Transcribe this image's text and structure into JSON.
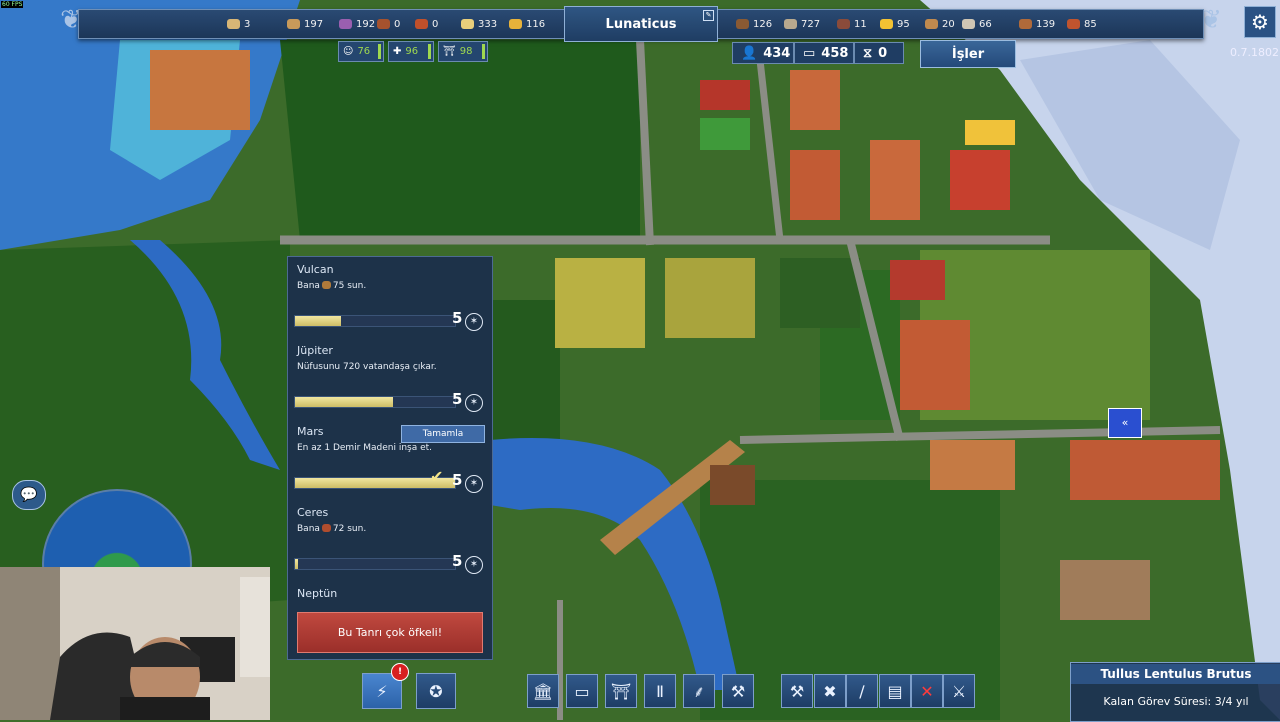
{
  "fps": "60 FPS",
  "city": {
    "name": "Lunaticus"
  },
  "resources_left": [
    {
      "icon": "bread-icon",
      "value": "3",
      "color": "#d8b676"
    },
    {
      "icon": "amphora-icon",
      "value": "197",
      "color": "#c89a5a"
    },
    {
      "icon": "grapes-icon",
      "value": "192",
      "color": "#9a5fb0"
    },
    {
      "icon": "meat-icon",
      "value": "0",
      "color": "#a5522e"
    },
    {
      "icon": "fish-icon",
      "value": "0",
      "color": "#c0502b"
    },
    {
      "icon": "wheat-icon",
      "value": "333",
      "color": "#e9cf7b"
    },
    {
      "icon": "cheese-icon",
      "value": "116",
      "color": "#e7b23a"
    }
  ],
  "resources_right": [
    {
      "icon": "wood-icon",
      "value": "126",
      "color": "#8a5a33"
    },
    {
      "icon": "stone-icon",
      "value": "727",
      "color": "#b8a98e"
    },
    {
      "icon": "iron-icon",
      "value": "11",
      "color": "#8a4b3a"
    },
    {
      "icon": "gold-icon",
      "value": "95",
      "color": "#f2c233"
    },
    {
      "icon": "crate-icon",
      "value": "20",
      "color": "#c08a4e"
    },
    {
      "icon": "marble-icon",
      "value": "66",
      "color": "#cfc6b4"
    },
    {
      "icon": "log-icon",
      "value": "139",
      "color": "#b06a3a"
    },
    {
      "icon": "brick-icon",
      "value": "85",
      "color": "#c0542e"
    }
  ],
  "stats": {
    "happiness": {
      "icon": "happiness-icon",
      "value": "76"
    },
    "health": {
      "icon": "health-icon",
      "value": "96"
    },
    "culture": {
      "icon": "temple-icon",
      "value": "98"
    }
  },
  "population": {
    "value": "434",
    "housing": "458",
    "idle": "0"
  },
  "jobs_label": "İşler",
  "version": "0.7.1802",
  "gods": [
    {
      "name": "Vulcan",
      "desc_prefix": "Bana",
      "desc_suffix": "75 sun.",
      "offer_color": "#b07a3a",
      "progress": 0.29,
      "favor": "5"
    },
    {
      "name": "Jüpiter",
      "desc": "Nüfusunu 720 vatandaşa çıkar.",
      "progress": 0.61,
      "favor": "5"
    },
    {
      "name": "Mars",
      "desc": "En az 1 Demir Madeni inşa et.",
      "progress": 1.0,
      "favor": "5",
      "complete_label": "Tamamla"
    },
    {
      "name": "Ceres",
      "desc_prefix": "Bana",
      "desc_suffix": "72 sun.",
      "offer_color": "#b04d2e",
      "progress": 0.02,
      "favor": "5"
    },
    {
      "name": "Neptün",
      "alert": "Bu Tanrı çok öfkeli!"
    }
  ],
  "toolbar": {
    "powers_badge": "!",
    "buttons": [
      {
        "name": "powers-button",
        "icon": "lightning-icon"
      },
      {
        "name": "favor-button",
        "icon": "laurel-star-icon"
      },
      {
        "name": "civic-button",
        "icon": "building-icon"
      },
      {
        "name": "housing-button",
        "icon": "house-icon"
      },
      {
        "name": "temple-button",
        "icon": "temple-icon"
      },
      {
        "name": "monument-button",
        "icon": "column-icon"
      },
      {
        "name": "farm-button",
        "icon": "wheat-icon"
      },
      {
        "name": "industry-button",
        "icon": "hammer-icon"
      },
      {
        "name": "tools-button",
        "icon": "crossed-hammers-icon"
      },
      {
        "name": "demolish-tools-button",
        "icon": "demolish-icon"
      },
      {
        "name": "road-button",
        "icon": "road-icon"
      },
      {
        "name": "wall-button",
        "icon": "wall-icon"
      },
      {
        "name": "delete-button",
        "icon": "x-icon"
      },
      {
        "name": "sword-button",
        "icon": "sword-icon"
      }
    ]
  },
  "quest": {
    "title": "Tullus Lentulus Brutus",
    "subtitle": "Kalan Görev Süresi: 3/4 yıl"
  }
}
